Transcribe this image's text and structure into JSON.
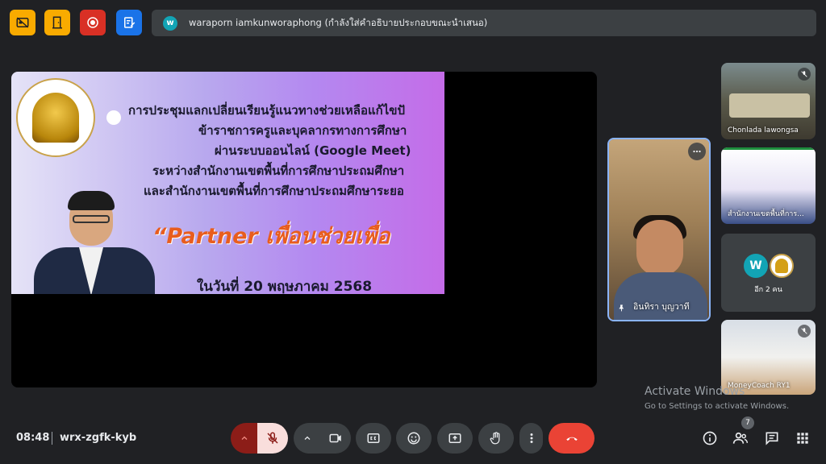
{
  "top_bar": {
    "buttons": [
      {
        "icon": "no-cc-icon",
        "color": "#f9ab00"
      },
      {
        "icon": "door-icon",
        "color": "#f9ab00"
      },
      {
        "icon": "record-icon",
        "color": "#d93025"
      },
      {
        "icon": "edit-doc-icon",
        "color": "#1a73e8"
      }
    ],
    "presenter_avatar": "w",
    "presenter_notice": "waraporn iamkunworaphong (กำลังใส่คำอธิบายประกอบขณะนำเสนอ)"
  },
  "slide": {
    "lines": [
      "การประชุมแลกเปลี่ยนเรียนรู้แนวทางช่วยเหลือแก้ไขปั",
      "ข้าราชการครูและบุคลากรทางการศึกษา",
      "ผ่านระบบออนไลน์ (Google Meet)",
      "ระหว่างสำนักงานเขตพื้นที่การศึกษาประถมศึกษา",
      "และสำนักงานเขตพื้นที่การศึกษาประถมศึกษาระยอ"
    ],
    "partner": "“Partner เพื่อนช่วยเพื่อ",
    "date": "ในวันที่ 20 พฤษภาคม 2568"
  },
  "speaker": {
    "name": "อินทิรา บุญวาที"
  },
  "tiles": [
    {
      "name": "Chonlada lawongsa"
    },
    {
      "name": "สำนักงานเขตพื้นที่การ..."
    },
    {
      "avatar": "W",
      "more": "อีก 2 คน"
    },
    {
      "name": "MoneyCoach RY1"
    }
  ],
  "watermark": {
    "title": "Activate Windows",
    "subtitle": "Go to Settings to activate Windows."
  },
  "bottom_bar": {
    "time": "08:48",
    "meeting_code": "wrx-zgfk-kyb",
    "people_count": "7",
    "end_call_color": "#ea4335"
  }
}
